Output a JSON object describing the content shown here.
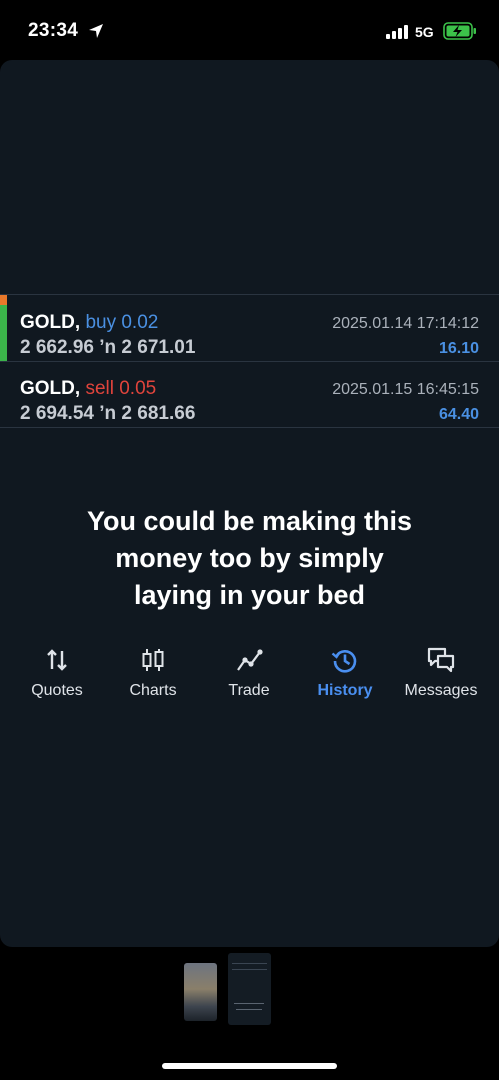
{
  "status_bar": {
    "time": "23:34",
    "network": "5G"
  },
  "trades": [
    {
      "symbol": "GOLD,",
      "side": "buy 0.02",
      "open_price": "2 662.96",
      "close_price": "2 671.01",
      "arrow": "ʼn",
      "date": "2025.01.14 17:14:12",
      "profit": "16.10"
    },
    {
      "symbol": "GOLD,",
      "side": "sell 0.05",
      "open_price": "2 694.54",
      "close_price": "2 681.66",
      "arrow": "ʼn",
      "date": "2025.01.15 16:45:15",
      "profit": "64.40"
    }
  ],
  "overlay_text": [
    "You could be making this",
    "money too by simply",
    "laying in your bed"
  ],
  "tabs": [
    {
      "label": "Quotes",
      "icon": "quotes-arrows-icon",
      "active": false
    },
    {
      "label": "Charts",
      "icon": "candlestick-icon",
      "active": false
    },
    {
      "label": "Trade",
      "icon": "trade-line-icon",
      "active": false
    },
    {
      "label": "History",
      "icon": "history-clock-icon",
      "active": true
    },
    {
      "label": "Messages",
      "icon": "chat-bubbles-icon",
      "active": false
    }
  ],
  "colors": {
    "buy": "#4a90e2",
    "sell": "#e0443c",
    "active_tab": "#4a8ff0",
    "background": "#101820"
  }
}
